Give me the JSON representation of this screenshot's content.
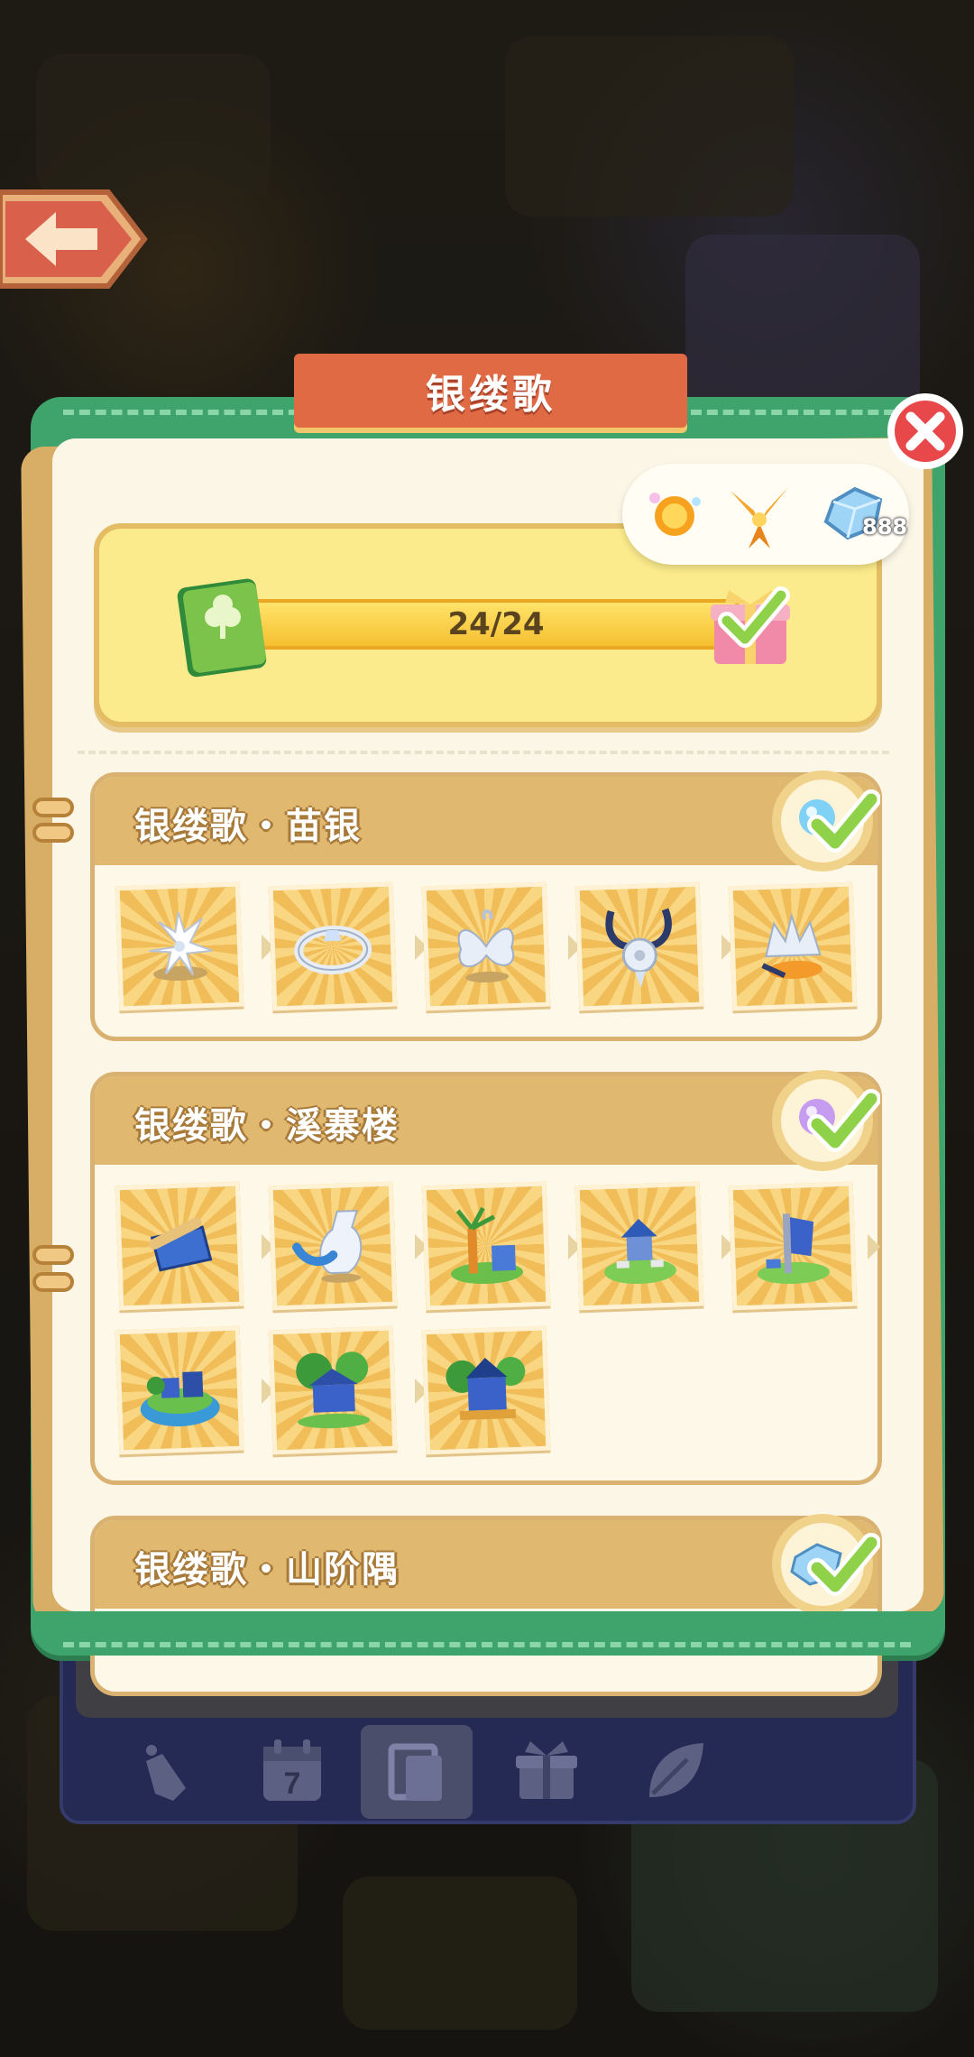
{
  "title": "银缕歌",
  "progress": {
    "label": "24/24",
    "current": 24,
    "total": 24,
    "claimed": true
  },
  "rewards": {
    "items": [
      {
        "icon": "sun-orb-icon"
      },
      {
        "icon": "golden-bird-icon"
      },
      {
        "icon": "diamond-icon",
        "count": "888"
      }
    ]
  },
  "sections": [
    {
      "title": "银缕歌・苗银",
      "completed": true,
      "badge_icon": "blue-orb-icon",
      "items": [
        {
          "icon": "silver-flower-icon"
        },
        {
          "icon": "silver-bracelet-icon"
        },
        {
          "icon": "silver-butterfly-hairpin-icon"
        },
        {
          "icon": "silver-pendant-icon"
        },
        {
          "icon": "silver-crown-icon"
        }
      ]
    },
    {
      "title": "银缕歌・溪寨楼",
      "completed": true,
      "badge_icon": "purple-orb-icon",
      "items": [
        {
          "icon": "blue-scroll-icon"
        },
        {
          "icon": "blue-vase-icon"
        },
        {
          "icon": "bamboo-plant-icon"
        },
        {
          "icon": "small-shrine-icon"
        },
        {
          "icon": "banner-post-icon"
        },
        {
          "icon": "island-village-icon"
        },
        {
          "icon": "stilt-house-icon"
        },
        {
          "icon": "blue-pavilion-icon"
        }
      ]
    },
    {
      "title": "银缕歌・山阶隅",
      "completed": true,
      "badge_icon": "diamond-badge-icon",
      "items": []
    }
  ],
  "dock": {
    "tabs": [
      {
        "icon": "hand-tab-icon",
        "active": false
      },
      {
        "icon": "calendar-tab-icon",
        "label": "7",
        "active": false
      },
      {
        "icon": "album-tab-icon",
        "active": true
      },
      {
        "icon": "gift-tab-icon",
        "active": false
      },
      {
        "icon": "leaf-tab-icon",
        "active": false
      }
    ]
  },
  "colors": {
    "book_green": "#3fa36c",
    "banner_red": "#e06a44",
    "check_green": "#8fd24a",
    "page_cream": "#fbf6e6"
  }
}
